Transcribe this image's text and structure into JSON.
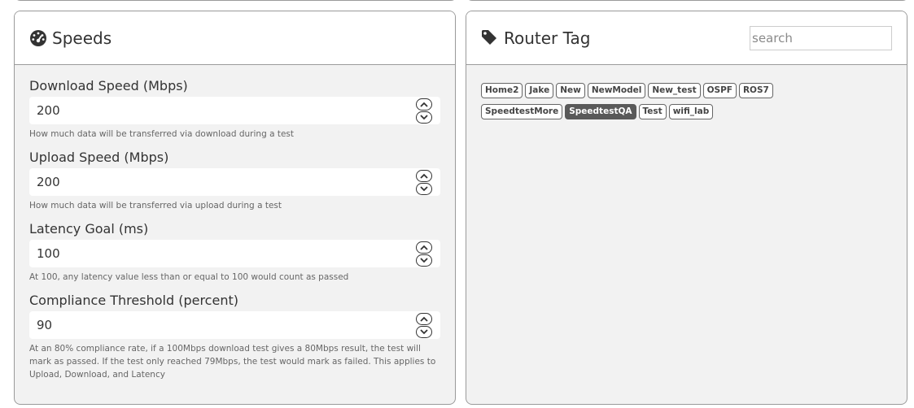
{
  "speeds": {
    "title": "Speeds",
    "header_icon": "tachometer-icon",
    "fields": [
      {
        "label": "Download Speed (Mbps)",
        "value": "200",
        "help": "How much data will be transferred via download during a test"
      },
      {
        "label": "Upload Speed (Mbps)",
        "value": "200",
        "help": "How much data will be transferred via upload during a test"
      },
      {
        "label": "Latency Goal (ms)",
        "value": "100",
        "help": "At 100, any latency value less than or equal to 100 would count as passed"
      },
      {
        "label": "Compliance Threshold (percent)",
        "value": "90",
        "help": "At an 80% compliance rate, if a 100Mbps download test gives a 80Mbps result, the test will mark as passed. If the test only reached 79Mbps, the test would mark as failed. This applies to Upload, Download, and Latency"
      }
    ]
  },
  "router_tag": {
    "title": "Router Tag",
    "header_icon": "tag-icon",
    "search_placeholder": "search",
    "tags": [
      {
        "label": "Home2",
        "selected": false
      },
      {
        "label": "Jake",
        "selected": false
      },
      {
        "label": "New",
        "selected": false
      },
      {
        "label": "NewModel",
        "selected": false
      },
      {
        "label": "New_test",
        "selected": false
      },
      {
        "label": "OSPF",
        "selected": false
      },
      {
        "label": "ROS7",
        "selected": false
      },
      {
        "label": "SpeedtestMore",
        "selected": false
      },
      {
        "label": "SpeedtestQA",
        "selected": true
      },
      {
        "label": "Test",
        "selected": false
      },
      {
        "label": "wifi_lab",
        "selected": false
      }
    ]
  },
  "colors": {
    "panel_background": "#f2f2f2",
    "border": "#9a9a9a",
    "selected_tag": "#595959"
  }
}
